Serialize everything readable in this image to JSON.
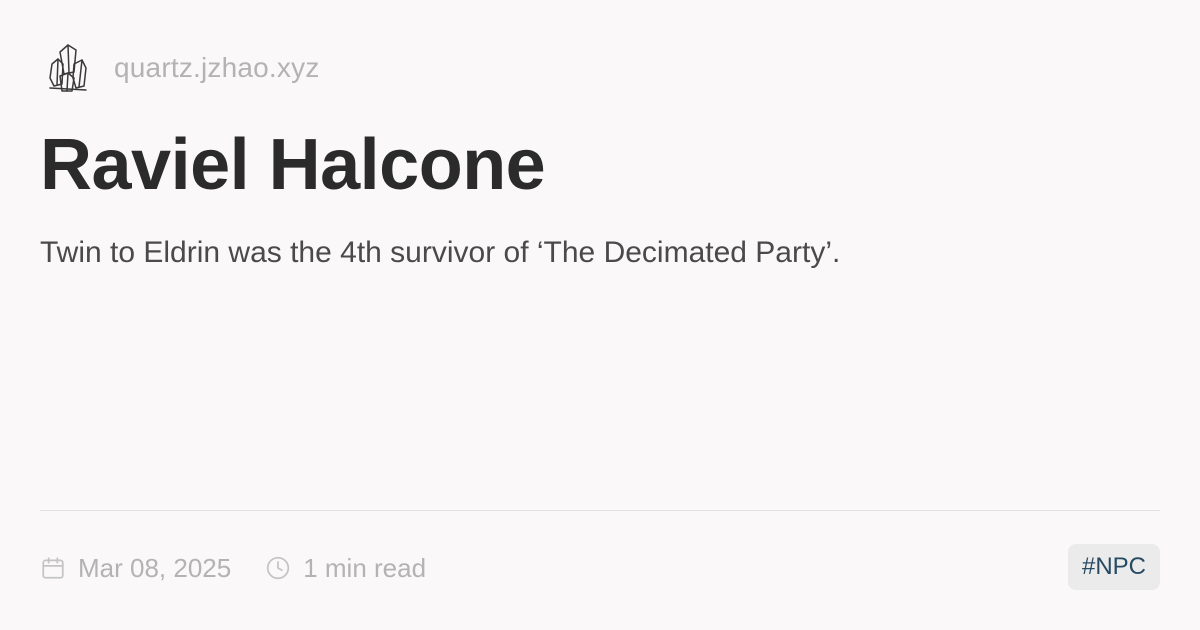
{
  "site": {
    "logo_icon": "crystal-logo-icon",
    "name": "quartz.jzhao.xyz"
  },
  "page": {
    "title": "Raviel Halcone",
    "description": "Twin to Eldrin was the 4th survivor of ‘The Decimated Party’."
  },
  "meta": {
    "date_icon": "calendar-icon",
    "date": "Mar 08, 2025",
    "reading_icon": "clock-icon",
    "reading_time": "1 min read"
  },
  "tags": [
    {
      "label": "#NPC"
    }
  ],
  "colors": {
    "background": "#faf8f8",
    "title": "#2b2b2b",
    "muted": "#b3b3b3",
    "tag_text": "#284b63",
    "tag_bg": "#ebebeb"
  }
}
